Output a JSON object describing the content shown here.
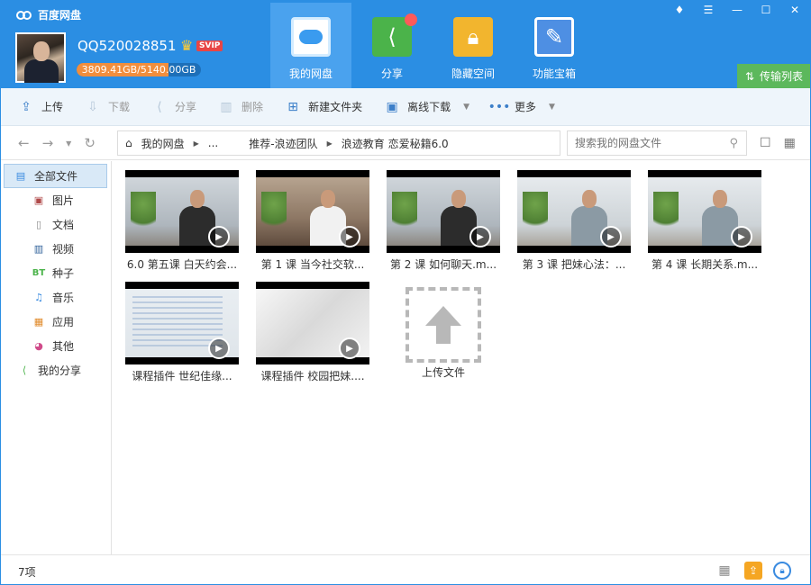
{
  "app": {
    "title": "百度网盘"
  },
  "user": {
    "name": "QQ520028851",
    "badge": "SVIP",
    "quota_text": "3809.41GB/5140.00GB",
    "quota_fraction": 0.741
  },
  "nav": [
    {
      "label": "我的网盘",
      "icon": "cloud-icon",
      "active": true
    },
    {
      "label": "分享",
      "icon": "share-icon",
      "active": false
    },
    {
      "label": "隐藏空间",
      "icon": "lock-icon",
      "active": false
    },
    {
      "label": "功能宝箱",
      "icon": "tools-icon",
      "active": false
    }
  ],
  "transfer": {
    "label": "传输列表"
  },
  "toolbar": {
    "upload": "上传",
    "download": "下载",
    "share": "分享",
    "delete": "删除",
    "new_folder": "新建文件夹",
    "offline": "离线下载",
    "more": "更多"
  },
  "breadcrumb": [
    "我的网盘",
    "...",
    "推荐-浪迹团队",
    "浪迹教育 恋爱秘籍6.0"
  ],
  "search": {
    "placeholder": "搜索我的网盘文件"
  },
  "sidebar": {
    "all": "全部文件",
    "items": [
      "图片",
      "文档",
      "视频",
      "种子",
      "音乐",
      "应用",
      "其他"
    ],
    "my_share": "我的分享"
  },
  "files": [
    {
      "label": "6.0 第五课 白天约会...",
      "scene": "dark"
    },
    {
      "label": "第 1 课  当今社交软...",
      "scene": "crowd"
    },
    {
      "label": "第 2 课  如何聊天.m...",
      "scene": "dark"
    },
    {
      "label": "第 3 课  把妹心法：...",
      "scene": "light"
    },
    {
      "label": "第 4 课  长期关系.m...",
      "scene": "light"
    },
    {
      "label": "课程插件  世纪佳缘...",
      "scene": "screen"
    },
    {
      "label": "课程插件  校园把妹....",
      "scene": "blank"
    }
  ],
  "upload_tile": {
    "label": "上传文件"
  },
  "status": {
    "count": "7项"
  },
  "colors": {
    "header": "#2b8ee3",
    "accent_green": "#5cb85c",
    "quota_fill": "#f18e3d"
  }
}
